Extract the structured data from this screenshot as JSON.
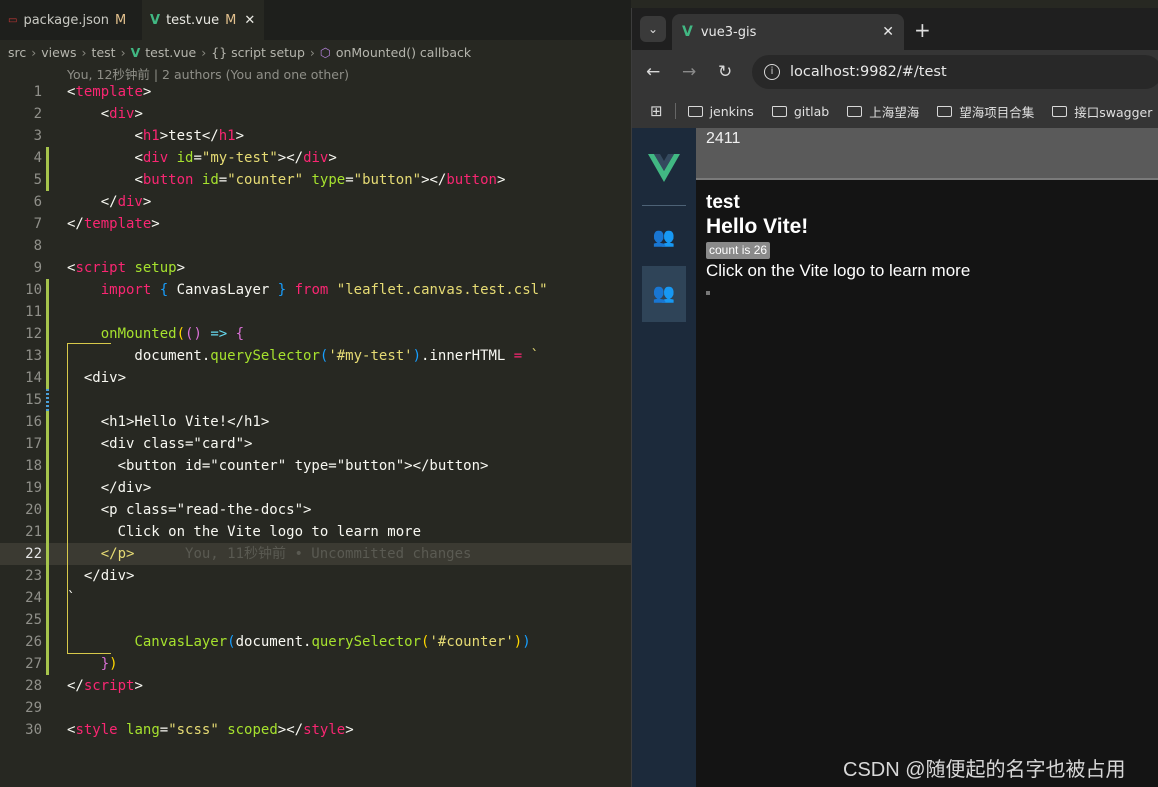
{
  "editor": {
    "tabs": [
      {
        "label": "package.json",
        "status": "M"
      },
      {
        "label": "test.vue",
        "status": "M"
      }
    ],
    "breadcrumb": [
      "src",
      "views",
      "test",
      "test.vue",
      "{} script setup",
      "onMounted() callback"
    ],
    "blame": "You, 12秒钟前 | 2 authors (You and one other)",
    "lines": [
      {
        "n": "1"
      },
      {
        "n": "2"
      },
      {
        "n": "3"
      },
      {
        "n": "4"
      },
      {
        "n": "5"
      },
      {
        "n": "6"
      },
      {
        "n": "7"
      },
      {
        "n": "8"
      },
      {
        "n": "9"
      },
      {
        "n": "10"
      },
      {
        "n": "11"
      },
      {
        "n": "12"
      },
      {
        "n": "13"
      },
      {
        "n": "14"
      },
      {
        "n": "15"
      },
      {
        "n": "16"
      },
      {
        "n": "17"
      },
      {
        "n": "18"
      },
      {
        "n": "19"
      },
      {
        "n": "20"
      },
      {
        "n": "21"
      },
      {
        "n": "22"
      },
      {
        "n": "23"
      },
      {
        "n": "24"
      },
      {
        "n": "25"
      },
      {
        "n": "26"
      },
      {
        "n": "27"
      },
      {
        "n": "28"
      },
      {
        "n": "29"
      },
      {
        "n": "30"
      }
    ],
    "ghost_blame": "You, 11秒钟前 • Uncommitted changes"
  },
  "browser": {
    "tab_title": "vue3-gis",
    "url": "localhost:9982/#/test",
    "bookmarks": [
      "jenkins",
      "gitlab",
      "上海望海",
      "望海项目合集",
      "接口swagger"
    ],
    "topbar_value": "2411",
    "page": {
      "heading": "test",
      "hello": "Hello Vite!",
      "count_button": "count is 26",
      "learn_more": "Click on the Vite logo to learn more"
    },
    "watermark": "CSDN @随便起的名字也被占用"
  }
}
